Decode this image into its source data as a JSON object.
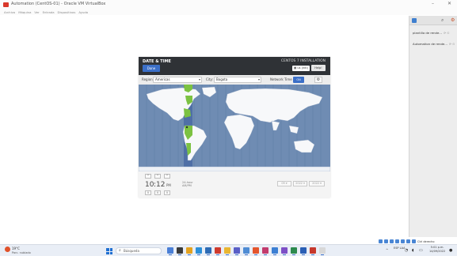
{
  "window": {
    "title": "Automation (CentOS-01) - Oracle VM VirtualBox",
    "minimize": "–",
    "close": "✕"
  },
  "menu": [
    "Archivo",
    "Máquina",
    "Ver",
    "Entrada",
    "Dispositivos",
    "Ayuda"
  ],
  "library": {
    "items": [
      {
        "label": "plantilla de rende...",
        "extra": "⟳ ⊙"
      },
      {
        "label": "Automation de rende...",
        "extra": "⟳ ⊙"
      }
    ]
  },
  "installer": {
    "section_title": "DATE & TIME",
    "done_label": "Done",
    "product": "CENTOS 7 INSTALLATION",
    "keyboard": "us (intl)",
    "help_label": "Help!",
    "region_label": "Region:",
    "region_value": "Americas",
    "city_label": "City:",
    "city_value": "Bogota",
    "network_time_label": "Network Time",
    "network_time_state": "ON",
    "time": {
      "hours": "10",
      "separator": ":",
      "minutes": "12",
      "ampm": "PM",
      "formats": "24-hour\nAM/PM"
    },
    "date_buttons": [
      "09 ▾",
      "2022 ▾",
      "2022 ▾"
    ]
  },
  "taskbar": {
    "temp": "19°C",
    "condition": "Parc. nublado",
    "search_placeholder": "Búsqueda",
    "lang": "ESP\nLAA",
    "clock_time": "5:01 p.m.",
    "clock_date": "14/09/2022"
  },
  "vm_status": "Ctrl derecho",
  "colors": {
    "ocean": "#6f8cb3",
    "land": "#f7f8fa",
    "timezone_band": "#4f6fa6",
    "selected_zone": "#7cc242",
    "accent": "#3b6fc7"
  }
}
